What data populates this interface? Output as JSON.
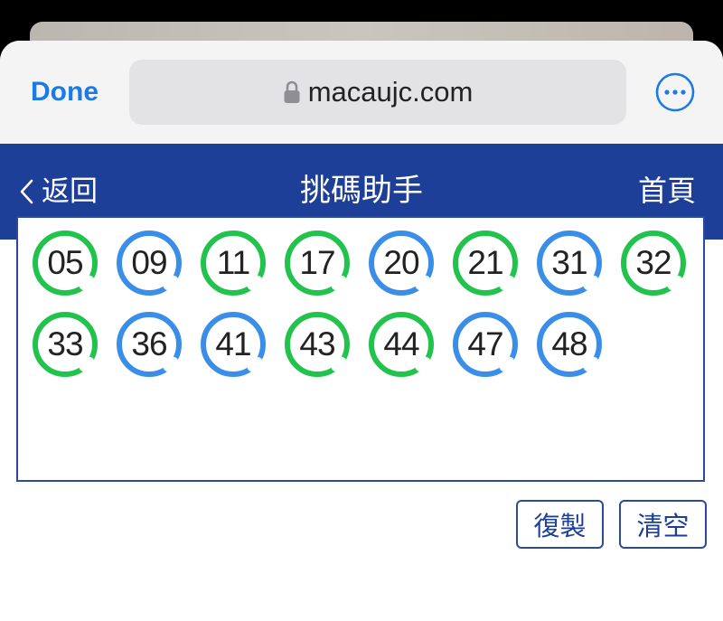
{
  "browser": {
    "done_label": "Done",
    "url": "macaujc.com"
  },
  "nav": {
    "back_label": "返回",
    "title": "挑碼助手",
    "home_label": "首頁"
  },
  "balls": [
    {
      "number": "05",
      "color": "green"
    },
    {
      "number": "09",
      "color": "blue"
    },
    {
      "number": "11",
      "color": "green"
    },
    {
      "number": "17",
      "color": "green"
    },
    {
      "number": "20",
      "color": "blue"
    },
    {
      "number": "21",
      "color": "green"
    },
    {
      "number": "31",
      "color": "blue"
    },
    {
      "number": "32",
      "color": "green"
    },
    {
      "number": "33",
      "color": "green"
    },
    {
      "number": "36",
      "color": "blue"
    },
    {
      "number": "41",
      "color": "blue"
    },
    {
      "number": "43",
      "color": "green"
    },
    {
      "number": "44",
      "color": "green"
    },
    {
      "number": "47",
      "color": "blue"
    },
    {
      "number": "48",
      "color": "blue"
    }
  ],
  "actions": {
    "copy_label": "復製",
    "clear_label": "清空"
  },
  "colors": {
    "nav_bg": "#1d3f97",
    "link_blue": "#1a7ae6",
    "ball_green": "#22c34c",
    "ball_blue": "#3b8ee8"
  }
}
